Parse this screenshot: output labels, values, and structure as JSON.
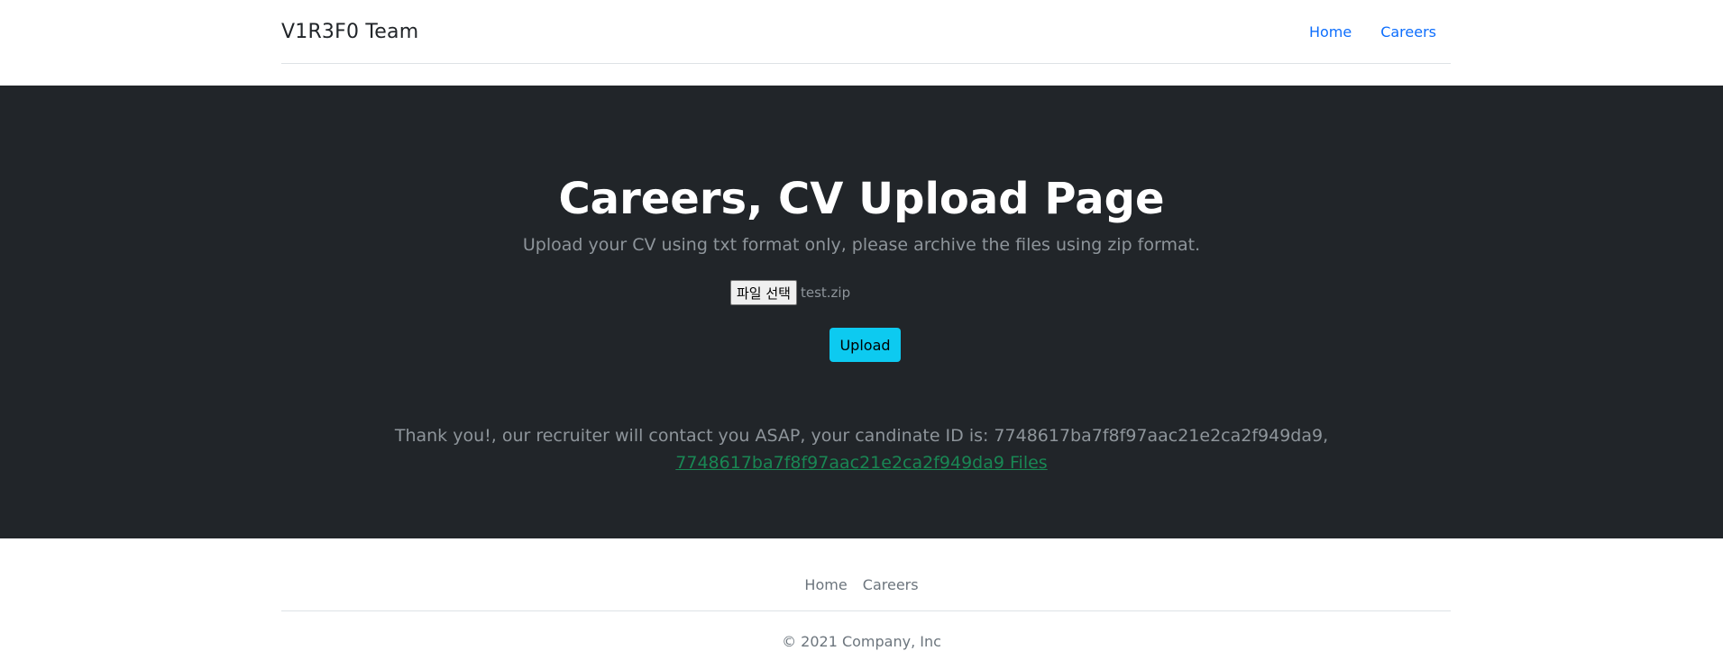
{
  "header": {
    "brand": "V1R3F0 Team",
    "nav": [
      {
        "label": "Home"
      },
      {
        "label": "Careers"
      }
    ]
  },
  "hero": {
    "title": "Careers, CV Upload Page",
    "lead": "Upload your CV using txt format only, please archive the files using zip format.",
    "file_button_label": "파일 선택",
    "file_name": "test.zip",
    "upload_label": "Upload",
    "thanks_text": "Thank you!, our recruiter will contact you ASAP, your candinate ID is: 7748617ba7f8f97aac21e2ca2f949da9,",
    "files_link": "7748617ba7f8f97aac21e2ca2f949da9 Files"
  },
  "footer": {
    "nav": [
      {
        "label": "Home"
      },
      {
        "label": "Careers"
      }
    ],
    "copyright": "© 2021 Company, Inc"
  },
  "colors": {
    "hero_bg": "#212529",
    "link": "#0d6efd",
    "upload_button": "#0dcaf0",
    "files_link": "#198754"
  }
}
